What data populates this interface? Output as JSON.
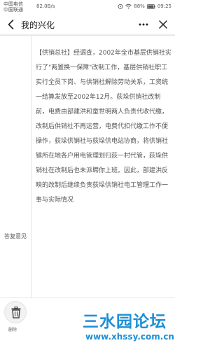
{
  "status_bar": {
    "carrier_1": "中国电信",
    "carrier_2": "中国联通",
    "speed": "82.0B/s",
    "battery": "88%",
    "time": "09:25"
  },
  "nav": {
    "title": "我的兴化"
  },
  "reply": {
    "label": "答复意见",
    "text": "【供销总社】经调查，2002年全市基层供销社实行了\"两置换一保障\"改制工作，基层供销社职工实行全员下岗、与供销社解除劳动关系，工资统一结算发放至2002年12月。荻垛供销社改制前，电费由部建洪和童世明两人负责代收代缴，改制后供销社不再运营，电费代扣代缴工作不便操作，荻垛供销社与荻垛供电站协商，将供销社镇所在地各户用电管理划归荻一村代管，荻垛供销社在改制后也未派聘你上班。因此，部建洪反映的改制后继续负责荻垛供销社电工管理工作一事与实际情况"
  },
  "bottom": {
    "delete_label": "删除"
  },
  "watermark": {
    "title": "三水园论坛",
    "url": "www.xhssy.com.cn"
  },
  "colors": {
    "watermark": "#1e8fd6",
    "text": "#555555"
  }
}
